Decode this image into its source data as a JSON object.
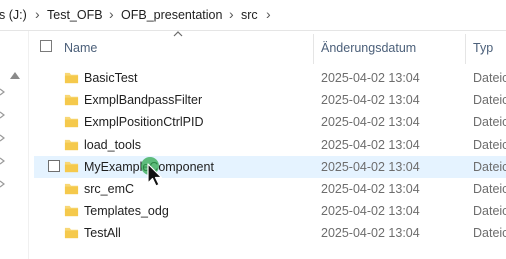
{
  "breadcrumb": {
    "items": [
      "s (J:)",
      "Test_OFB",
      "OFB_presentation",
      "src"
    ],
    "separator": "›"
  },
  "columns": {
    "name": "Name",
    "date": "Änderungsdatum",
    "type": "Typ"
  },
  "rows": [
    {
      "name": "BasicTest",
      "date": "2025-04-02 13:04",
      "type": "Dateic"
    },
    {
      "name": "ExmplBandpassFilter",
      "date": "2025-04-02 13:04",
      "type": "Dateic"
    },
    {
      "name": "ExmplPositionCtrlPID",
      "date": "2025-04-02 13:04",
      "type": "Dateic"
    },
    {
      "name": "load_tools",
      "date": "2025-04-02 13:04",
      "type": "Dateic"
    },
    {
      "name": "MyExampleComponent",
      "date": "2025-04-02 13:04",
      "type": "Dateic"
    },
    {
      "name": "src_emC",
      "date": "2025-04-02 13:04",
      "type": "Dateic"
    },
    {
      "name": "Templates_odg",
      "date": "2025-04-02 13:04",
      "type": "Dateic"
    },
    {
      "name": "TestAll",
      "date": "2025-04-02 13:04",
      "type": "Dateic"
    }
  ],
  "colors": {
    "folder": "#f8d775",
    "hover_row": "#e5f3ff",
    "cursor_highlight": "#2fa84f"
  }
}
